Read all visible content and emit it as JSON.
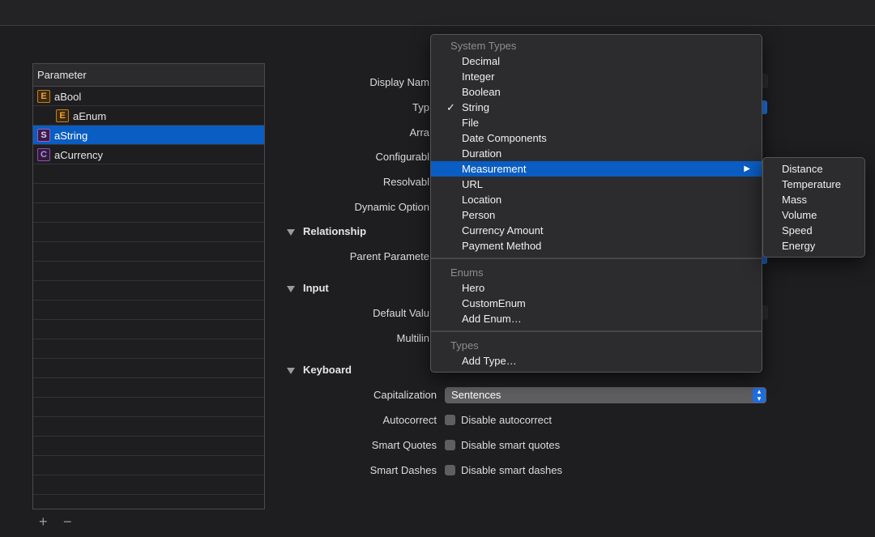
{
  "parameters": {
    "header": "Parameter",
    "rows": [
      {
        "badge": "E",
        "name": "aBool"
      },
      {
        "badge": "E",
        "name": "aEnum"
      },
      {
        "badge": "S",
        "name": "aString"
      },
      {
        "badge": "C",
        "name": "aCurrency"
      }
    ],
    "selected_row": "aString",
    "add_label": "+",
    "remove_label": "−"
  },
  "form": {
    "labels": {
      "display_name": "Display Nam",
      "type": "Typ",
      "array": "Arra",
      "configurable": "Configurabl",
      "resolvable": "Resolvabl",
      "dynamic_options": "Dynamic Option",
      "parent_parameter": "Parent Paramete",
      "default_value": "Default Valu",
      "multiline": "Multilin",
      "capitalization": "Capitalization",
      "autocorrect": "Autocorrect",
      "smart_quotes": "Smart Quotes",
      "smart_dashes": "Smart Dashes"
    },
    "sections": {
      "relationship": "Relationship",
      "input": "Input",
      "keyboard": "Keyboard"
    },
    "capitalization_value": "Sentences",
    "checkboxes": {
      "autocorrect": "Disable autocorrect",
      "smart_quotes": "Disable smart quotes",
      "smart_dashes": "Disable smart dashes"
    }
  },
  "type_menu": {
    "system_types_header": "System Types",
    "system_types": [
      "Decimal",
      "Integer",
      "Boolean",
      "String",
      "File",
      "Date Components",
      "Duration",
      "Measurement",
      "URL",
      "Location",
      "Person",
      "Currency Amount",
      "Payment Method"
    ],
    "checked": "String",
    "highlighted": "Measurement",
    "check_mark": "✓",
    "submenu_arrow": "▶",
    "enums_header": "Enums",
    "enums": [
      "Hero",
      "CustomEnum",
      "Add Enum…"
    ],
    "types_header": "Types",
    "types": [
      "Add Type…"
    ]
  },
  "measurement_submenu": [
    "Distance",
    "Temperature",
    "Mass",
    "Volume",
    "Speed",
    "Energy"
  ],
  "colors": {
    "background": "#1e1e20",
    "selection": "#0a5dc2",
    "accent": "#1f6fe0",
    "enum_badge": "#f3a431",
    "struct_badge": "#a757c7"
  }
}
